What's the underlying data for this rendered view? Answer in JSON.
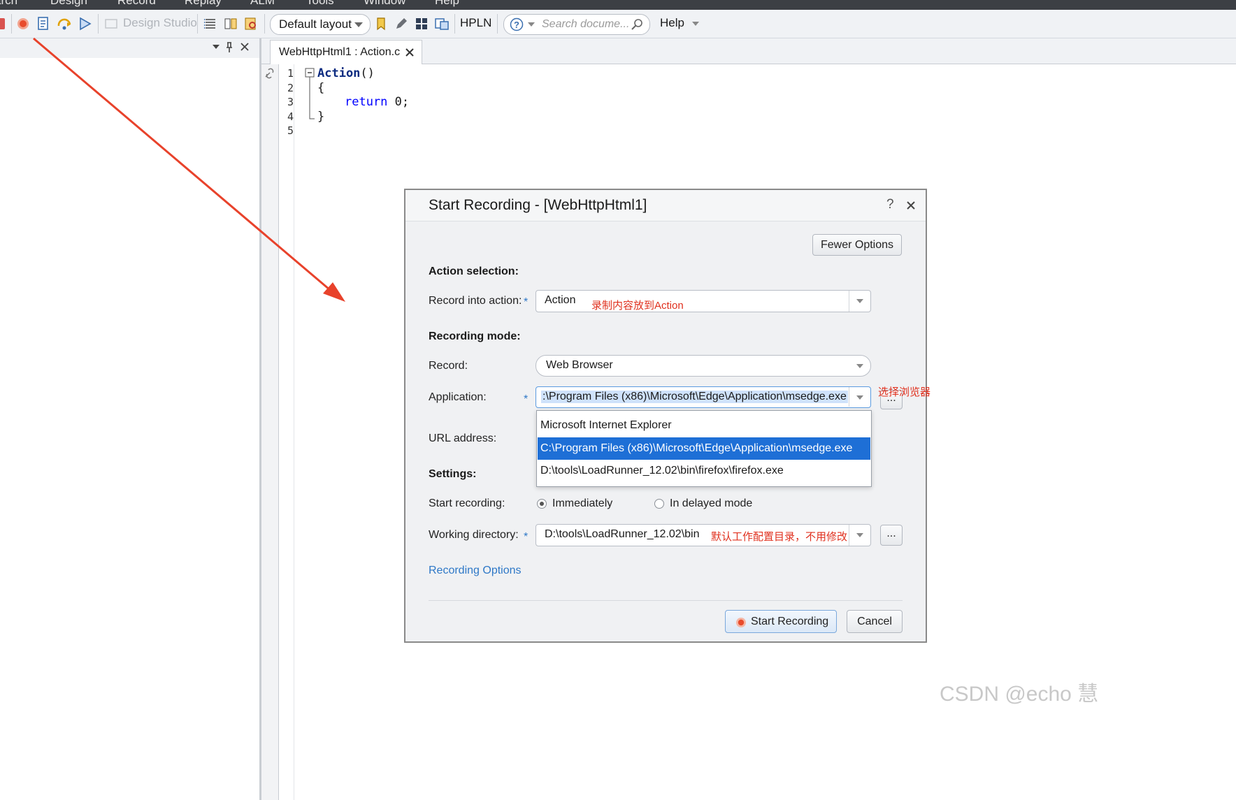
{
  "menu": [
    "arch",
    "Design",
    "Record",
    "Replay",
    "ALM",
    "Tools",
    "Window",
    "Help"
  ],
  "toolbar": {
    "design_studio": "Design Studio",
    "layout": "Default layout",
    "hpln": "HPLN",
    "search_placeholder": "Search docume...",
    "help": "Help"
  },
  "editor": {
    "tab_label": "WebHttpHtml1 : Action.c",
    "line_numbers": [
      "1",
      "2",
      "3",
      "4",
      "5"
    ],
    "code": {
      "line1_fn": "Action",
      "line1_paren": "()",
      "line2": "{",
      "line3_kw": "return",
      "line3_rest": " 0;",
      "line4": "}"
    }
  },
  "dialog": {
    "title": "Start Recording - [WebHttpHtml1]",
    "help_glyph": "?",
    "fewer_options": "Fewer Options",
    "action_selection": "Action selection:",
    "record_into_action_label": "Record into action:",
    "record_into_action_value": "Action",
    "recording_mode": "Recording mode:",
    "record_label": "Record:",
    "record_value": "Web Browser",
    "application_label": "Application:",
    "application_value": ":\\Program Files (x86)\\Microsoft\\Edge\\Application\\msedge.exe",
    "application_options": [
      "Microsoft Internet Explorer",
      "C:\\Program Files (x86)\\Microsoft\\Edge\\Application\\msedge.exe",
      "D:\\tools\\LoadRunner_12.02\\bin\\firefox\\firefox.exe"
    ],
    "url_label": "URL address:",
    "settings": "Settings:",
    "start_recording_label": "Start recording:",
    "immediately": "Immediately",
    "delayed": "In delayed mode",
    "working_dir_label": "Working directory:",
    "working_dir_value": "D:\\tools\\LoadRunner_12.02\\bin",
    "browse": "...",
    "recording_options": "Recording Options",
    "start_button": "Start Recording",
    "cancel_button": "Cancel",
    "required_mark": "*"
  },
  "annotations": {
    "action_note": "录制内容放到Action",
    "browser_note": "选择浏览器",
    "workdir_note": "默认工作配置目录，不用修改"
  },
  "watermark": "CSDN @echo 慧",
  "colors": {
    "accent_blue": "#1e6fd6",
    "link_blue": "#2e78c7",
    "annotation_red": "#e0301e",
    "keyword_blue": "#0000ff"
  }
}
